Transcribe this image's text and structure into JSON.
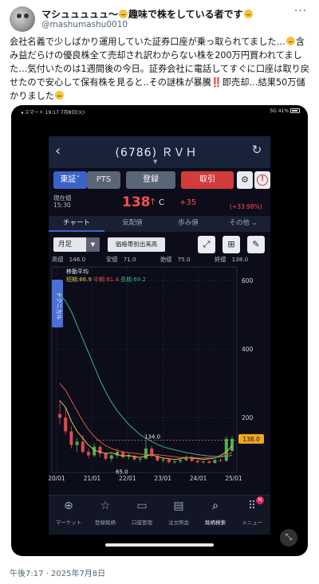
{
  "tweet": {
    "display_name": "マシュュュュュ～",
    "display_name_suffix": "趣味で株をしている者です",
    "handle": "@mashumashu0010",
    "more_label": "···",
    "text_part1": "会社名義で少しばかり運用していた証券口座が乗っ取られてました…",
    "text_part2": "含み益だらけの優良株全て売却され訳わからない株を200万円買われてました…気付いたのは1週間後の今日。証券会社に電話してすぐに口座は取り戻せたので安心して保有株を見ると..その謎株が暴騰",
    "text_bang": "‼️",
    "text_part3": "即売却…結果50万儲かりました",
    "timestamp": "午後7:17 · 2025年7月8日"
  },
  "screenshot": {
    "status_left": "◂ スマート   19:17  7月8日(火)",
    "status_right": "5G 41%",
    "app": {
      "back_icon": "‹",
      "title": "(6786) ＲＶＨ",
      "refresh_icon": "↻",
      "buttons": {
        "tse": "東証ˇ",
        "pts": "PTS",
        "register": "登録",
        "trade": "取引",
        "bell": "🔔",
        "info": "!"
      },
      "price": {
        "label_line1": "現在値",
        "label_line2": "15:30",
        "value": "138",
        "arrow": "↑",
        "flag": "C",
        "change": "+35",
        "change_pct": "(+33.98%)"
      },
      "tabs": [
        "チャート",
        "気配値",
        "歩み値",
        "その他 ⌄"
      ],
      "controls": {
        "period": "月足",
        "period_caret": "▼",
        "volume_btn": "価格帯別出来高",
        "expand_icon": "⤢",
        "grid_icon": "⊞",
        "draw_icon": "✎"
      },
      "ohlc": {
        "high": "高値　146.0",
        "low": "安値　71.0",
        "open": "始値　75.0",
        "close": "終値　138.0"
      },
      "nav": [
        {
          "label": "マーケット",
          "icon": "⊕"
        },
        {
          "label": "登録銘柄",
          "icon": "☆"
        },
        {
          "label": "口座管理",
          "icon": "▭"
        },
        {
          "label": "注文照会",
          "icon": "▤"
        },
        {
          "label": "銘柄検索",
          "icon": "⌕"
        },
        {
          "label": "メニュー",
          "icon": "⠿"
        }
      ],
      "nav_badge": "N"
    }
  },
  "chart_data": {
    "type": "line",
    "title": "",
    "side_tab": "テクニカル",
    "ma_header": "移動平均",
    "legend": [
      {
        "name": "短期:66.9",
        "color": "#d9c84a"
      },
      {
        "name": "中期:61.4",
        "color": "#e0553f"
      },
      {
        "name": "長期:69.2",
        "color": "#3fb08a"
      }
    ],
    "y_ticks": [
      200,
      400,
      600
    ],
    "ylim": [
      40,
      640
    ],
    "x_ticks": [
      "20/01",
      "21/01",
      "22/01",
      "23/01",
      "24/01",
      "25/01"
    ],
    "annotations": {
      "high": "134.0",
      "low": "65.0",
      "current": "138.0"
    },
    "series": [
      {
        "name": "短期",
        "color": "#d9c84a",
        "values": [
          250,
          230,
          190,
          160,
          140,
          120,
          105,
          100,
          95,
          98,
          92,
          88,
          90,
          86,
          84,
          88,
          92,
          86,
          82,
          80,
          78,
          80,
          84,
          82,
          80,
          78,
          80,
          82,
          90,
          100,
          118
        ]
      },
      {
        "name": "中期",
        "color": "#e0553f",
        "values": [
          300,
          280,
          250,
          220,
          190,
          165,
          145,
          130,
          118,
          110,
          104,
          100,
          98,
          96,
          94,
          92,
          92,
          92,
          90,
          88,
          86,
          84,
          84,
          84,
          82,
          82,
          82,
          83,
          86,
          92,
          98
        ]
      },
      {
        "name": "長期",
        "color": "#3fb08a",
        "values": [
          560,
          540,
          510,
          470,
          430,
          390,
          350,
          310,
          275,
          245,
          220,
          200,
          180,
          165,
          150,
          140,
          130,
          122,
          115,
          110,
          106,
          102,
          98,
          95,
          92,
          90,
          88,
          87,
          86,
          87,
          90
        ]
      }
    ],
    "candles": [
      [
        210,
        250,
        180,
        200
      ],
      [
        200,
        230,
        150,
        160
      ],
      [
        160,
        175,
        110,
        120
      ],
      [
        120,
        140,
        100,
        130
      ],
      [
        130,
        150,
        95,
        100
      ],
      [
        100,
        110,
        80,
        90
      ],
      [
        90,
        125,
        85,
        115
      ],
      [
        115,
        120,
        85,
        95
      ],
      [
        95,
        100,
        75,
        80
      ],
      [
        80,
        95,
        72,
        90
      ],
      [
        90,
        110,
        82,
        100
      ],
      [
        100,
        104,
        80,
        85
      ],
      [
        85,
        95,
        78,
        88
      ],
      [
        88,
        92,
        74,
        78
      ],
      [
        78,
        84,
        70,
        80
      ],
      [
        80,
        134,
        78,
        110
      ],
      [
        110,
        118,
        84,
        88
      ],
      [
        88,
        90,
        72,
        75
      ],
      [
        75,
        82,
        68,
        78
      ],
      [
        78,
        80,
        66,
        70
      ],
      [
        70,
        76,
        65,
        72
      ],
      [
        72,
        80,
        68,
        76
      ],
      [
        76,
        90,
        72,
        84
      ],
      [
        84,
        88,
        70,
        74
      ],
      [
        74,
        78,
        66,
        70
      ],
      [
        70,
        75,
        65,
        72
      ],
      [
        72,
        76,
        66,
        68
      ],
      [
        68,
        80,
        66,
        76
      ],
      [
        76,
        82,
        70,
        74
      ],
      [
        74,
        146,
        71,
        138
      ],
      [
        103,
        146,
        100,
        138
      ]
    ]
  }
}
